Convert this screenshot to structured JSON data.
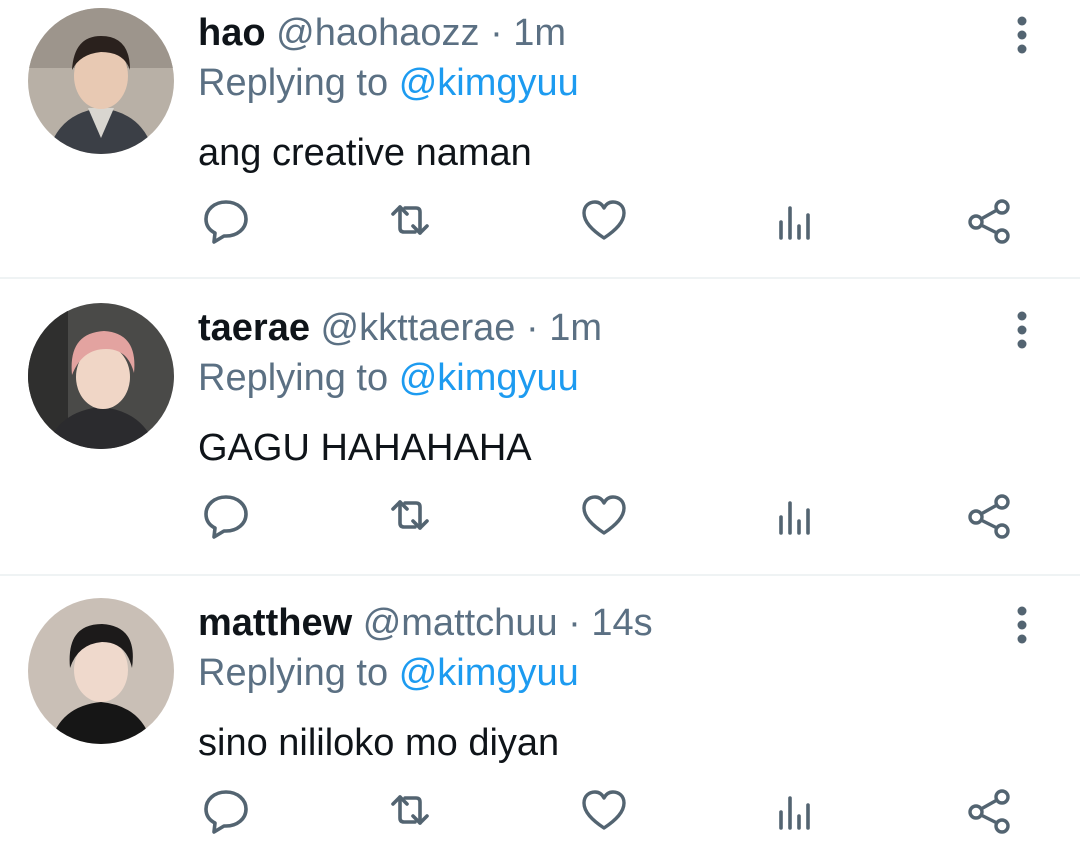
{
  "tweets": [
    {
      "display_name": "hao",
      "handle": "@haohaozz",
      "separator": "·",
      "time": "1m",
      "replying_prefix": "Replying to",
      "replying_to": "@kimgyuu",
      "text": "ang creative naman",
      "avatar": {
        "skin": "#e8c9b3",
        "hair": "#2a211d",
        "shirt": "#3b3f46",
        "bg": "#b8b0a6"
      }
    },
    {
      "display_name": "taerae",
      "handle": "@kkttaerae",
      "separator": "·",
      "time": "1m",
      "replying_prefix": "Replying to",
      "replying_to": "@kimgyuu",
      "text": "GAGU HAHAHAHA",
      "avatar": {
        "skin": "#f0d6c6",
        "hair": "#e3a3a0",
        "shirt": "#2b2b2e",
        "bg": "#4a4a48"
      }
    },
    {
      "display_name": "matthew",
      "handle": "@mattchuu",
      "separator": "·",
      "time": "14s",
      "replying_prefix": "Replying to",
      "replying_to": "@kimgyuu",
      "text": "sino nililoko mo diyan",
      "avatar": {
        "skin": "#efd9cc",
        "hair": "#1c1a1a",
        "shirt": "#161616",
        "bg": "#c9bfb6"
      }
    }
  ],
  "actions": [
    "reply-icon",
    "retweet-icon",
    "like-icon",
    "analytics-icon",
    "share-icon"
  ],
  "more_icon": "more-vertical-icon",
  "colors": {
    "primary_text": "#0f1419",
    "secondary_text": "#5b7083",
    "mention": "#1d9bf0",
    "divider": "#eff3f4"
  }
}
